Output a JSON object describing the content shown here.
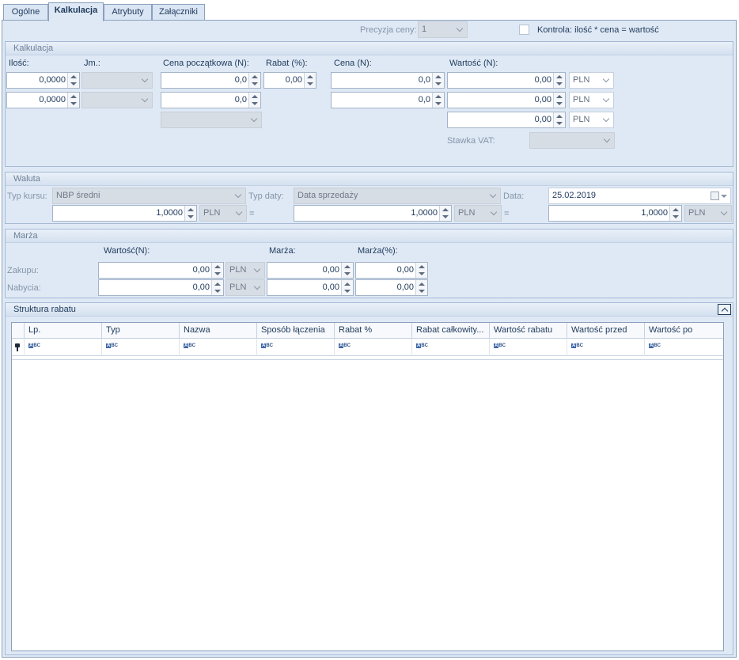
{
  "tabs": [
    {
      "label": "Ogólne",
      "active": false
    },
    {
      "label": "Kalkulacja",
      "active": true
    },
    {
      "label": "Atrybuty",
      "active": false
    },
    {
      "label": "Załączniki",
      "active": false
    }
  ],
  "top": {
    "precision_label": "Precyzja ceny:",
    "precision_value": "1",
    "control_label": "Kontrola: ilość * cena = wartość"
  },
  "kalkulacja": {
    "title": "Kalkulacja",
    "headers": {
      "qty": "Ilość:",
      "unit": "Jm.:",
      "base_price": "Cena początkowa (N):",
      "discount": "Rabat (%):",
      "price": "Cena (N):",
      "value": "Wartość (N):"
    },
    "row1": {
      "qty": "0,0000",
      "base_price": "0,0",
      "discount": "0,00",
      "price": "0,0",
      "value": "0,00",
      "currency": "PLN"
    },
    "row2": {
      "qty": "0,0000",
      "base_price": "0,0",
      "price": "0,0",
      "value": "0,00",
      "currency": "PLN"
    },
    "row3": {
      "value": "0,00",
      "currency": "PLN"
    },
    "vat_label": "Stawka VAT:"
  },
  "waluta": {
    "title": "Waluta",
    "rate_type_label": "Typ kursu:",
    "rate_type_value": "NBP średni",
    "date_type_label": "Typ daty:",
    "date_type_value": "Data sprzedaży",
    "date_label": "Data:",
    "date_value": "25.02.2019",
    "left_amount": "1,0000",
    "left_currency": "PLN",
    "mid_amount": "1,0000",
    "mid_currency": "PLN",
    "right_amount": "1,0000",
    "right_currency": "PLN",
    "equals": "="
  },
  "marza": {
    "title": "Marża",
    "col_value": "Wartość(N):",
    "col_margin": "Marża:",
    "col_margin_pct": "Marża(%):",
    "purchase_label": "Zakupu:",
    "acquisition_label": "Nabycia:",
    "purchase": {
      "value": "0,00",
      "currency": "PLN",
      "margin": "0,00",
      "margin_pct": "0,00"
    },
    "acquisition": {
      "value": "0,00",
      "currency": "PLN",
      "margin": "0,00",
      "margin_pct": "0,00"
    }
  },
  "struktura": {
    "title": "Struktura rabatu",
    "columns": [
      "Lp.",
      "Typ",
      "Nazwa",
      "Sposób łączenia",
      "Rabat %",
      "Rabat całkowity...",
      "Wartość rabatu",
      "Wartość przed",
      "Wartość po"
    ],
    "filter_glyph": "ABC"
  },
  "colors": {
    "panel_bg": "#dfe9f5",
    "border": "#8ba0bc",
    "text": "#1e395b"
  }
}
